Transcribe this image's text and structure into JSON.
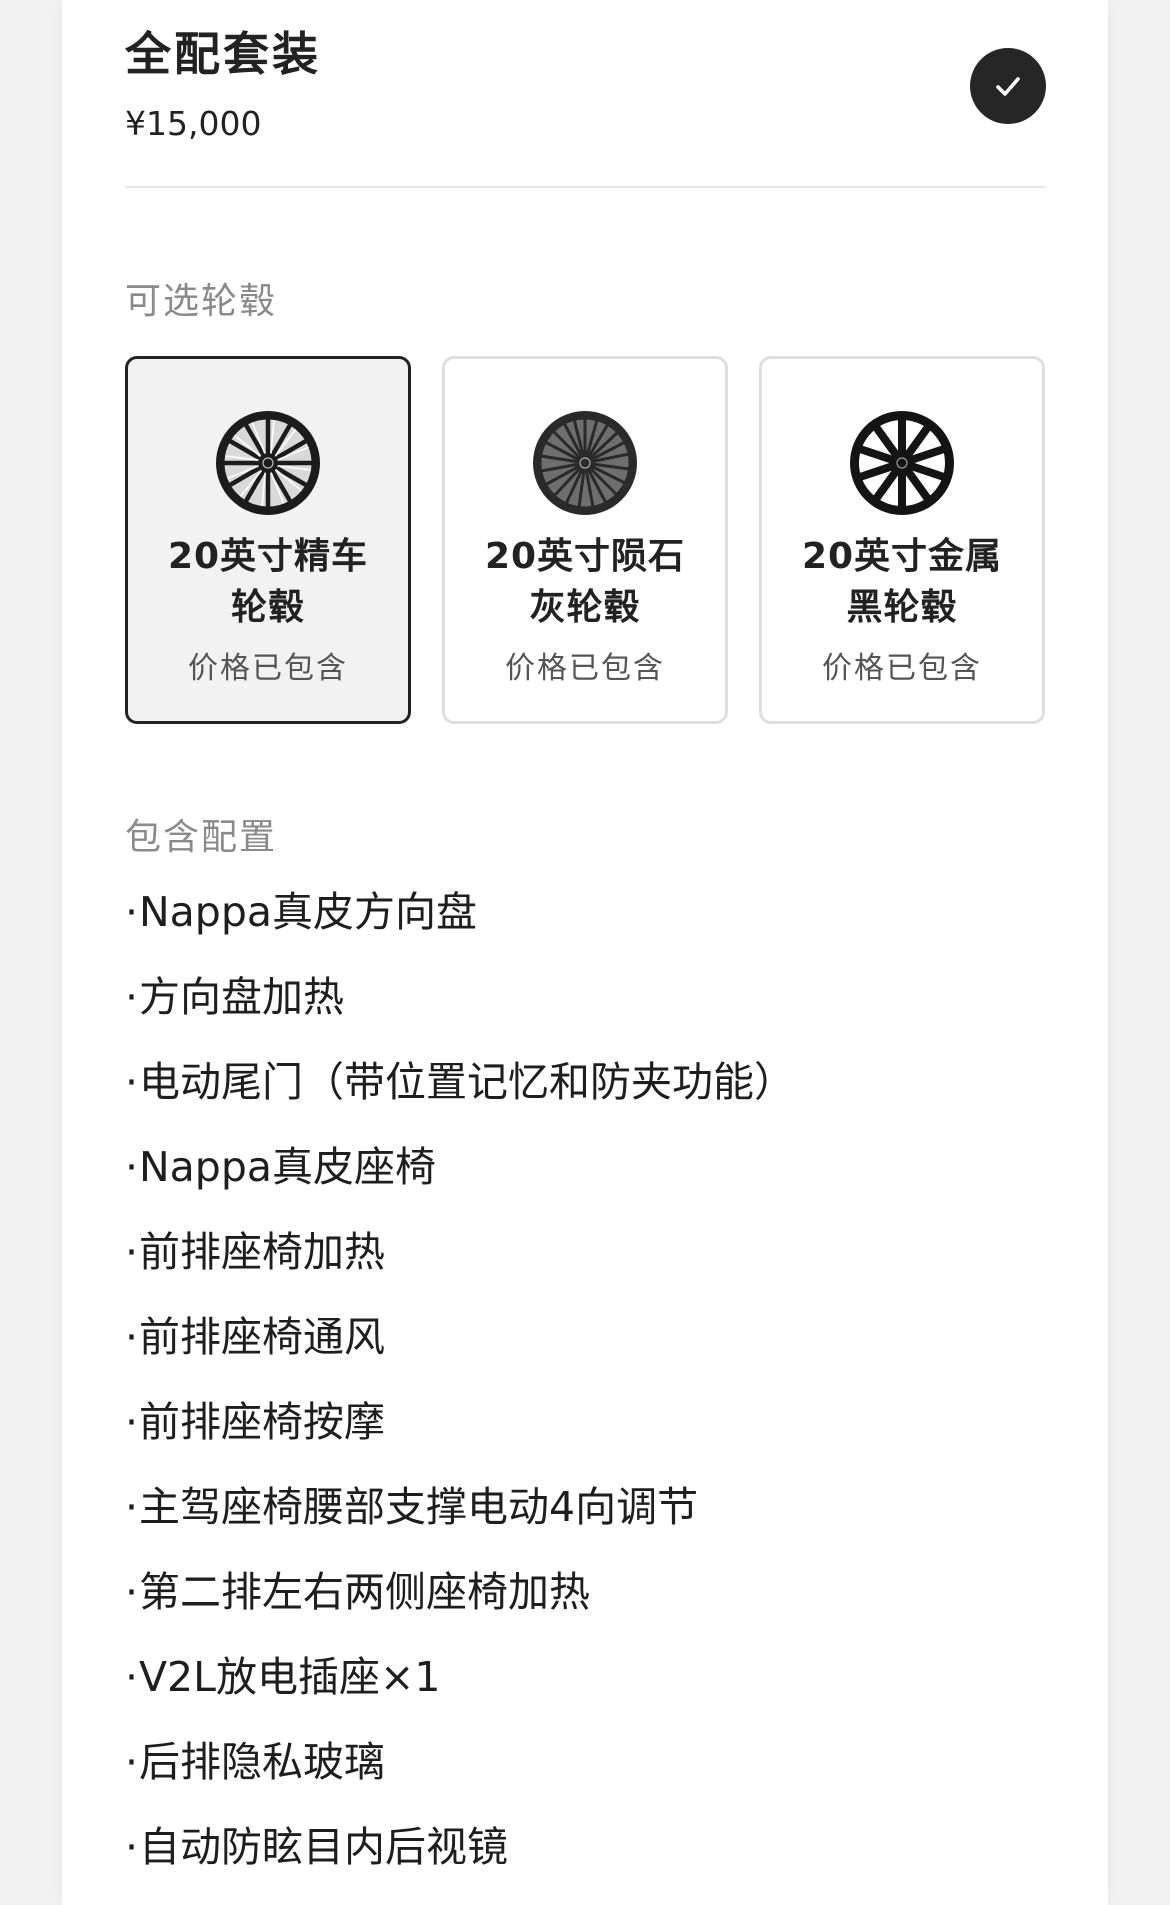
{
  "package": {
    "title": "全配套装",
    "price": "¥15,000",
    "selected": true
  },
  "wheels_section": {
    "label": "可选轮毂",
    "options": [
      {
        "name": "20英寸精车轮毂",
        "price_note": "价格已包含",
        "selected": true,
        "style": "machined"
      },
      {
        "name": "20英寸陨石灰轮毂",
        "price_note": "价格已包含",
        "selected": false,
        "style": "meteor-gray"
      },
      {
        "name": "20英寸金属黑轮毂",
        "price_note": "价格已包含",
        "selected": false,
        "style": "metal-black"
      }
    ]
  },
  "features_section": {
    "label": "包含配置",
    "bullet": "·",
    "items": [
      "Nappa真皮方向盘",
      "方向盘加热",
      "电动尾门（带位置记忆和防夹功能）",
      "Nappa真皮座椅",
      "前排座椅加热",
      "前排座椅通风",
      "前排座椅按摩",
      "主驾座椅腰部支撑电动4向调节",
      "第二排左右两侧座椅加热",
      "V2L放电插座×1",
      "后排隐私玻璃",
      "自动防眩目内后视镜"
    ]
  },
  "icons": {
    "check": "check-icon",
    "wheel": "wheel-icon"
  },
  "colors": {
    "check_bg": "#262626",
    "selected_border": "#222222",
    "selected_bg": "#f2f2f2",
    "label_gray": "#8a8a8a"
  }
}
